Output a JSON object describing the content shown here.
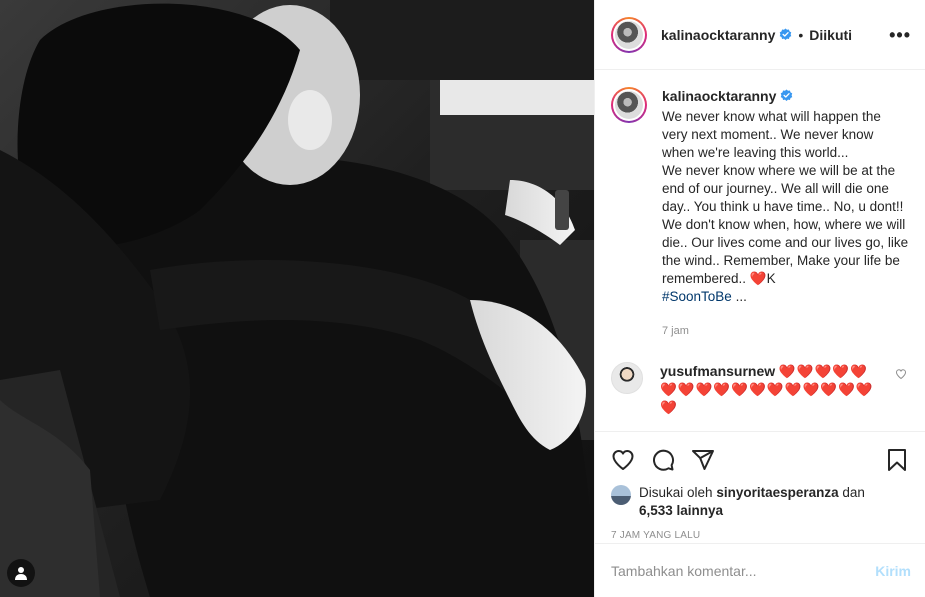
{
  "post": {
    "image_alt": "Black and white photo of two people hugging",
    "user_tag_icon": "user-tag-icon"
  },
  "header": {
    "username": "kalinaocktaranny",
    "verified": true,
    "separator": "•",
    "follow_status": "Diikuti",
    "more_label": "•••"
  },
  "caption": {
    "username": "kalinaocktaranny",
    "text": "We never know what will happen the very next moment.. We never know when we're leaving this world...\nWe never know where we will be at the end of our journey.. We all will die one day.. You think u have time.. No, u dont!! We don't know when, how, where we will die.. Our lives come and our lives go, like the wind.. Remember, Make your life be remembered.. ",
    "heart": "❤️",
    "suffix": "K",
    "hashtag": "#SoonToBe",
    "ellipsis": " ...",
    "time": "7 jam"
  },
  "comment": {
    "username": "yusufmansurnew",
    "hearts": "❤️❤️❤️❤️❤️❤️❤️❤️❤️❤️❤️❤️❤️❤️❤️❤️❤️❤️"
  },
  "likes": {
    "prefix": "Disukai oleh",
    "liker": "sinyoritaesperanza",
    "connector": "dan",
    "others": "6,533 lainnya"
  },
  "post_age": "7 jam yang lalu",
  "add_comment": {
    "placeholder": "Tambahkan komentar...",
    "post_label": "Kirim"
  },
  "colors": {
    "accent": "#0095f6",
    "hashtag": "#00376b",
    "muted": "#8e8e8e",
    "post_disabled": "#b2dffc",
    "heart": "#ed1c24"
  }
}
